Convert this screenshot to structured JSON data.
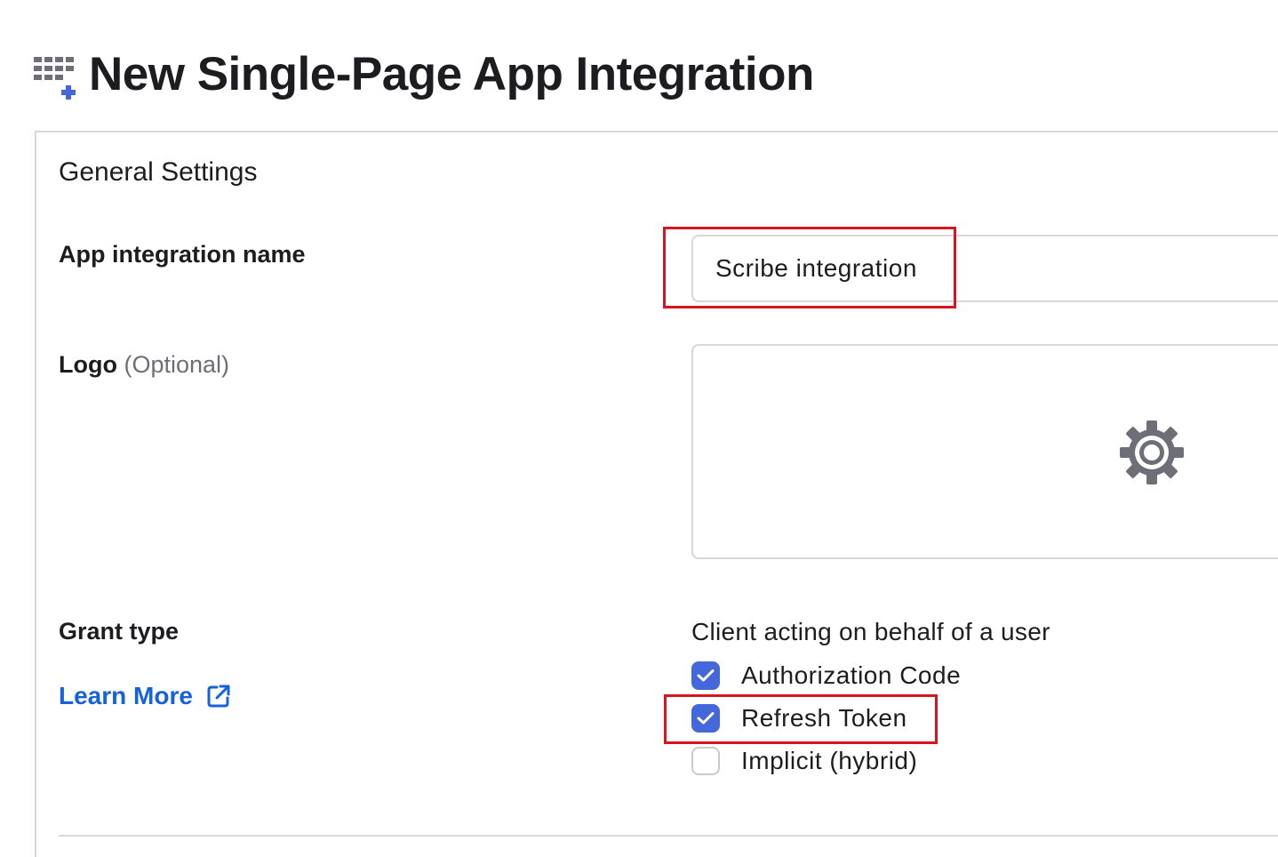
{
  "header": {
    "title": "New Single-Page App Integration",
    "icon": "add-app-grid-icon"
  },
  "general_settings": {
    "title": "General Settings",
    "app_name": {
      "label": "App integration name",
      "value": "Scribe integration"
    },
    "logo": {
      "label": "Logo",
      "optional_label": "(Optional)",
      "icon": "gear-icon"
    },
    "grant_type": {
      "label": "Grant type",
      "learn_more": "Learn More",
      "heading": "Client acting on behalf of a user",
      "options": [
        {
          "label": "Authorization Code",
          "checked": true
        },
        {
          "label": "Refresh Token",
          "checked": true
        },
        {
          "label": "Implicit (hybrid)",
          "checked": false
        }
      ]
    }
  },
  "colors": {
    "accent": "#4468d9",
    "link": "#1662dd",
    "highlight": "#d9141f",
    "border": "#d7d7dc"
  }
}
